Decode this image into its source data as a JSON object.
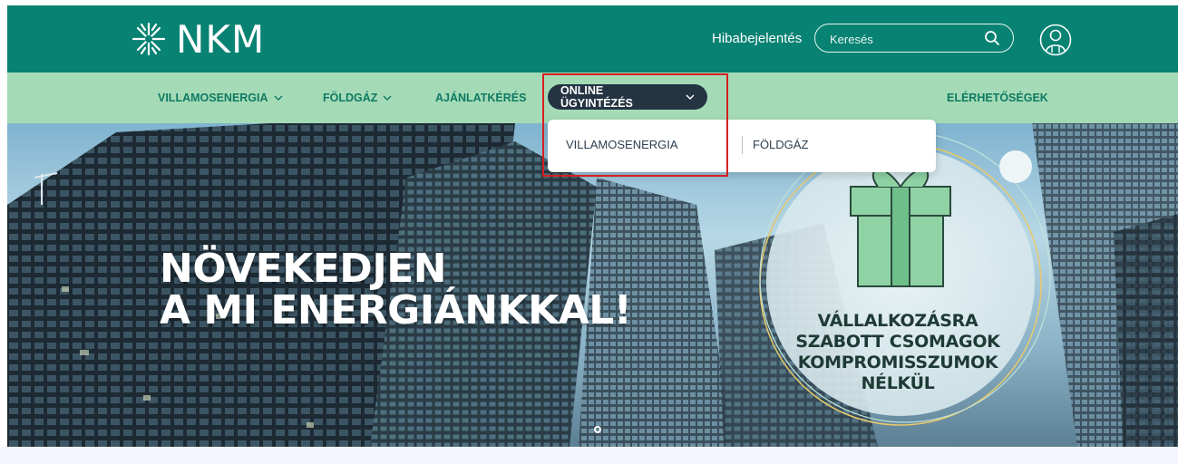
{
  "header": {
    "logo_text": "NKM",
    "report_link": "Hibabejelentés",
    "search": {
      "placeholder": "Keresés"
    },
    "icons": {
      "logo": "nkm-snowflake-logo",
      "search": "search-icon",
      "user": "user-account-icon"
    }
  },
  "nav": {
    "items": [
      {
        "label": "VILLAMOSENERGIA",
        "has_dropdown": true
      },
      {
        "label": "FÖLDGÁZ",
        "has_dropdown": true
      },
      {
        "label": "AJÁNLATKÉRÉS",
        "has_dropdown": false
      },
      {
        "label": "ONLINE ÜGYINTÉZÉS",
        "has_dropdown": true,
        "active": true
      },
      {
        "label": "ELÉRHETŐSÉGEK",
        "has_dropdown": false
      }
    ]
  },
  "dropdown": {
    "options": [
      {
        "label": "VILLAMOSENERGIA"
      },
      {
        "label": "FÖLDGÁZ"
      }
    ]
  },
  "hero": {
    "headline_line1": "NÖVEKEDJEN",
    "headline_line2": "A MI ENERGIÁNKKAL!",
    "badge_line1": "VÁLLALKOZÁSRA",
    "badge_line2": "SZABOTT CSOMAGOK",
    "badge_line3": "KOMPROMISSZUMOK",
    "badge_line4": "NÉLKÜL",
    "carousel": {
      "total_slides": 1,
      "current_slide": 1
    }
  },
  "colors": {
    "topbar": "#088272",
    "navbar": "#a4dbb6",
    "nav_text": "#0f7a63",
    "active_pill": "#243443",
    "highlight_border": "#d51f1f",
    "gift_green": "#8fd3a4"
  }
}
